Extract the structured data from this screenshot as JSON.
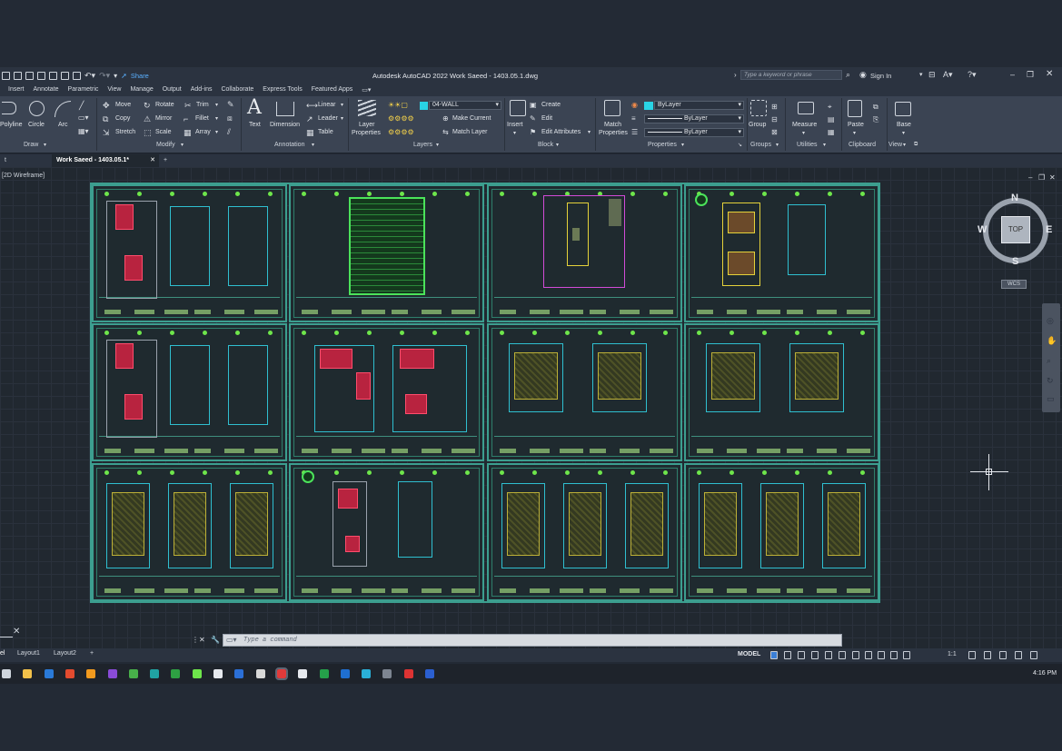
{
  "window": {
    "title": "Autodesk AutoCAD 2022   Work Saeed - 1403.05.1.dwg",
    "share_label": "Share",
    "search_placeholder": "Type a keyword or phrase",
    "sign_in": "Sign In"
  },
  "menu": [
    "Insert",
    "Annotate",
    "Parametric",
    "View",
    "Manage",
    "Output",
    "Add-ins",
    "Collaborate",
    "Express Tools",
    "Featured Apps"
  ],
  "ribbon": {
    "draw": {
      "polyline": "Polyline",
      "circle": "Circle",
      "arc": "Arc",
      "title": "Draw"
    },
    "modify": {
      "move": "Move",
      "rotate": "Rotate",
      "trim": "Trim",
      "copy": "Copy",
      "mirror": "Mirror",
      "fillet": "Fillet",
      "stretch": "Stretch",
      "scale": "Scale",
      "array": "Array",
      "title": "Modify"
    },
    "annotation": {
      "text": "Text",
      "dimension": "Dimension",
      "linear": "Linear",
      "leader": "Leader",
      "table": "Table",
      "title": "Annotation"
    },
    "layers": {
      "layer_properties_1": "Layer",
      "layer_properties_2": "Properties",
      "current_layer": "04-WALL",
      "make_current": "Make Current",
      "match_layer": "Match Layer",
      "title": "Layers"
    },
    "block": {
      "insert": "Insert",
      "create": "Create",
      "edit": "Edit",
      "edit_attributes": "Edit Attributes",
      "title": "Block"
    },
    "properties": {
      "match_1": "Match",
      "match_2": "Properties",
      "color": "ByLayer",
      "linetype": "ByLayer",
      "lineweight": "ByLayer",
      "title": "Properties"
    },
    "groups": {
      "group": "Group",
      "title": "Groups"
    },
    "utilities": {
      "measure": "Measure",
      "title": "Utilities"
    },
    "clipboard": {
      "paste": "Paste",
      "title": "Clipboard"
    },
    "view": {
      "base": "Base",
      "title": "View"
    }
  },
  "doctabs": {
    "active": "Work Saeed - 1403.05.1*"
  },
  "viewport": {
    "label": "[2D Wireframe]"
  },
  "viewcube": {
    "n": "N",
    "s": "S",
    "e": "E",
    "w": "W",
    "top": "TOP",
    "wcs": "WCS"
  },
  "command": {
    "placeholder": "Type a command"
  },
  "layouts": {
    "model": "el",
    "layout1": "Layout1",
    "layout2": "Layout2"
  },
  "status": {
    "model": "MODEL",
    "scale": "1:1"
  },
  "taskbar": {
    "time": "4:16 PM"
  },
  "colors": {
    "accent": "#2fbfd0",
    "sheet_border": "#3c9e8f",
    "wall": "#2fbfd0",
    "hatch": "#b8233f"
  }
}
